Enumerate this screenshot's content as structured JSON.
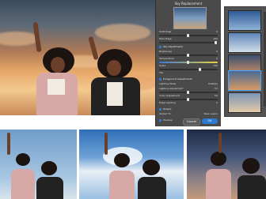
{
  "dialog": {
    "title": "Sky Replacement",
    "rows": [
      {
        "label": "Shift Edge",
        "value": "0"
      },
      {
        "label": "Fade Edge",
        "value": "100"
      },
      {
        "label": "Sky Adjustments",
        "section": true
      },
      {
        "label": "Brightness",
        "value": "0"
      },
      {
        "label": "Temperature",
        "value": "0"
      },
      {
        "label": "Scale",
        "value": "100"
      },
      {
        "label": "Flip",
        "section": false,
        "value": ""
      },
      {
        "label": "Foreground Adjustments",
        "section": true
      },
      {
        "label": "Lighting Mode",
        "value": "Multiply"
      },
      {
        "label": "Lighting Adjustment",
        "value": "50"
      },
      {
        "label": "Color Adjustment",
        "value": "50"
      },
      {
        "label": "Edge Lighting",
        "value": "0"
      },
      {
        "label": "Output",
        "section": true
      },
      {
        "label": "Output To",
        "value": "New Layers"
      }
    ],
    "preview_label": "Preview",
    "ok_label": "OK",
    "cancel_label": "Cancel"
  },
  "colors": {
    "dialog_bg": "#4a4a4a",
    "accent": "#2b79d0",
    "panel_bg": "#535353"
  }
}
